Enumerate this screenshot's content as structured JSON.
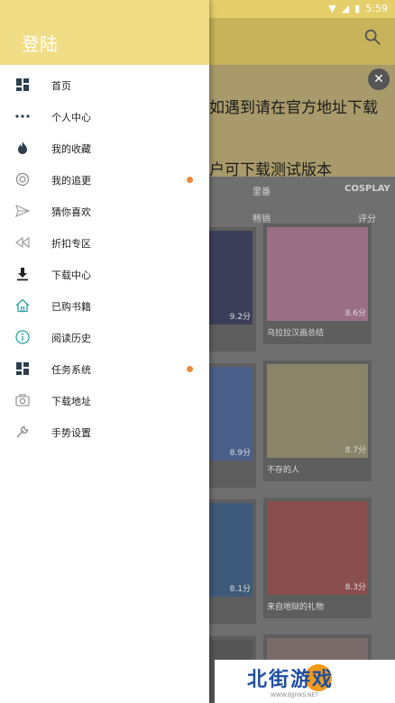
{
  "status_bar": {
    "time": "5:59"
  },
  "drawer": {
    "title": "登陆",
    "items": [
      {
        "label": "首页",
        "icon": "grid-icon",
        "badge": false
      },
      {
        "label": "个人中心",
        "icon": "more-dots-icon",
        "badge": false
      },
      {
        "label": "我的收藏",
        "icon": "flame-icon",
        "badge": false
      },
      {
        "label": "我的追更",
        "icon": "refresh-circle-icon",
        "badge": true
      },
      {
        "label": "猜你喜欢",
        "icon": "send-icon",
        "badge": false
      },
      {
        "label": "折扣专区",
        "icon": "rewind-icon",
        "badge": false
      },
      {
        "label": "下载中心",
        "icon": "download-icon",
        "badge": false
      },
      {
        "label": "已购书籍",
        "icon": "home-icon",
        "badge": false
      },
      {
        "label": "阅读历史",
        "icon": "info-icon",
        "badge": false
      },
      {
        "label": "任务系统",
        "icon": "grid-icon",
        "badge": true
      },
      {
        "label": "下载地址",
        "icon": "camera-icon",
        "badge": false
      },
      {
        "label": "手势设置",
        "icon": "wrench-icon",
        "badge": false
      }
    ],
    "badge_color": "#f08a3a"
  },
  "background": {
    "banner_line1": "如遇到请在官方地址下载",
    "banner_line2": "户可下载测试版本",
    "tabs": [
      "里番",
      "COSPLAY"
    ],
    "subtabs": [
      "畅销",
      "评分"
    ],
    "cards": [
      {
        "title": "乌拉拉汉画总结",
        "score": "8.6分"
      },
      {
        "title": "不存的人",
        "score": "8.7分"
      },
      {
        "title": "来自地狱的礼物",
        "score": "8.3分"
      }
    ],
    "left_scores": [
      "9.2分",
      "8.9分",
      "8.1分"
    ]
  },
  "watermark": {
    "text": "北街游戏",
    "sub": "WWW.BJJHXS.NET"
  }
}
